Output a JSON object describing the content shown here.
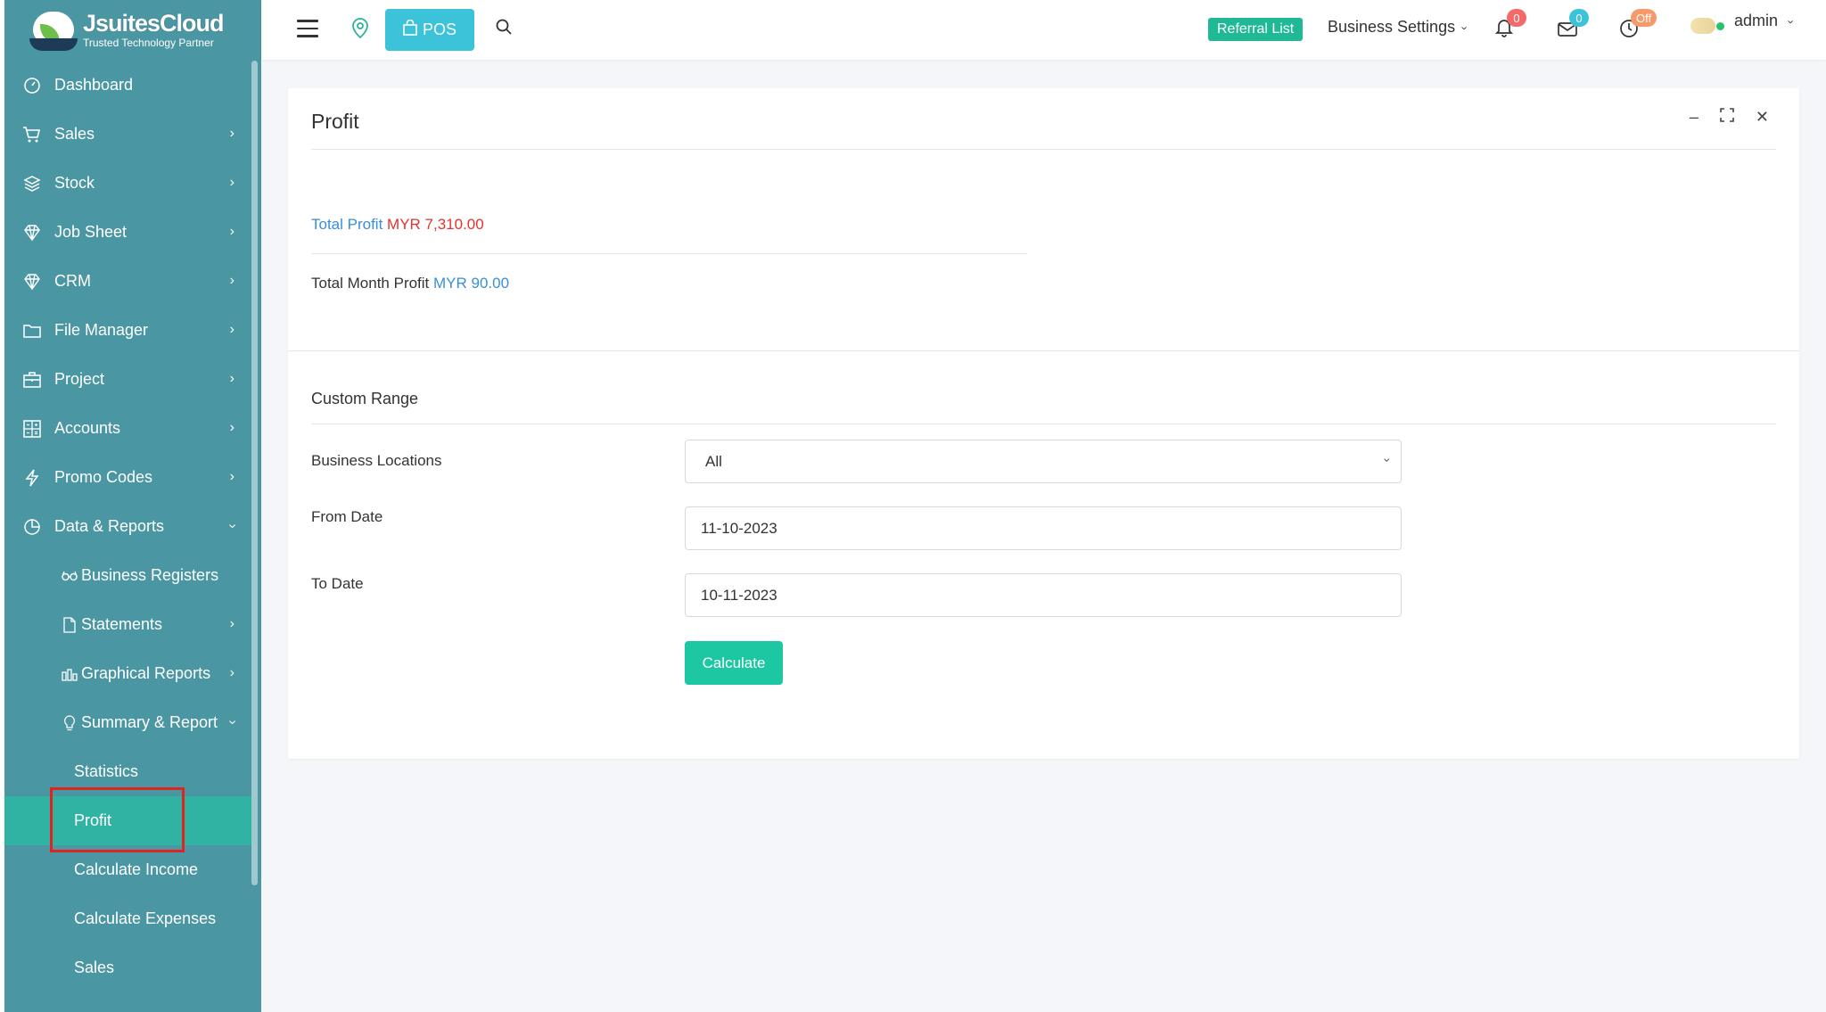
{
  "brand": {
    "title": "JsuitesCloud",
    "subtitle": "Trusted Technology Partner"
  },
  "sidebar": {
    "items": [
      {
        "label": "Dashboard",
        "icon": "gauge-icon"
      },
      {
        "label": "Sales",
        "icon": "cart-icon"
      },
      {
        "label": "Stock",
        "icon": "layers-icon"
      },
      {
        "label": "Job Sheet",
        "icon": "diamond-icon"
      },
      {
        "label": "CRM",
        "icon": "diamond-icon"
      },
      {
        "label": "File Manager",
        "icon": "folder-icon"
      },
      {
        "label": "Project",
        "icon": "briefcase-icon"
      },
      {
        "label": "Accounts",
        "icon": "calculator-icon"
      },
      {
        "label": "Promo Codes",
        "icon": "lightning-icon"
      },
      {
        "label": "Data & Reports",
        "icon": "pie-icon"
      }
    ],
    "data_reports_sub": [
      {
        "label": "Business Registers",
        "icon": "glasses-icon"
      },
      {
        "label": "Statements",
        "icon": "file-icon"
      },
      {
        "label": "Graphical Reports",
        "icon": "bar-chart-icon"
      },
      {
        "label": "Summary & Report",
        "icon": "bulb-icon"
      }
    ],
    "summary_sub": [
      {
        "label": "Statistics"
      },
      {
        "label": "Profit",
        "active": true
      },
      {
        "label": "Calculate Income"
      },
      {
        "label": "Calculate Expenses"
      },
      {
        "label": "Sales"
      }
    ]
  },
  "topbar": {
    "pos_label": "POS",
    "referral_label": "Referral List",
    "business_settings": "Business Settings",
    "notifications_count": "0",
    "messages_count": "0",
    "timer_status": "Off",
    "user": "admin"
  },
  "card": {
    "title": "Profit",
    "total_profit_label": "Total Profit",
    "total_profit_value": "MYR 7,310.00",
    "month_profit_label": "Total Month Profit",
    "month_profit_value": "MYR 90.00",
    "custom_range_title": "Custom Range",
    "business_locations_label": "Business Locations",
    "business_locations_value": "All",
    "from_date_label": "From Date",
    "from_date_value": "11-10-2023",
    "to_date_label": "To Date",
    "to_date_value": "10-11-2023",
    "calculate_label": "Calculate"
  },
  "colors": {
    "sidebar_bg": "#4a96a2",
    "active_item": "#30b3a3",
    "accent_green": "#1dc7a1",
    "pos_button": "#3cc3d9",
    "profit_red": "#e3342f",
    "link_blue": "#3a8ed8"
  }
}
